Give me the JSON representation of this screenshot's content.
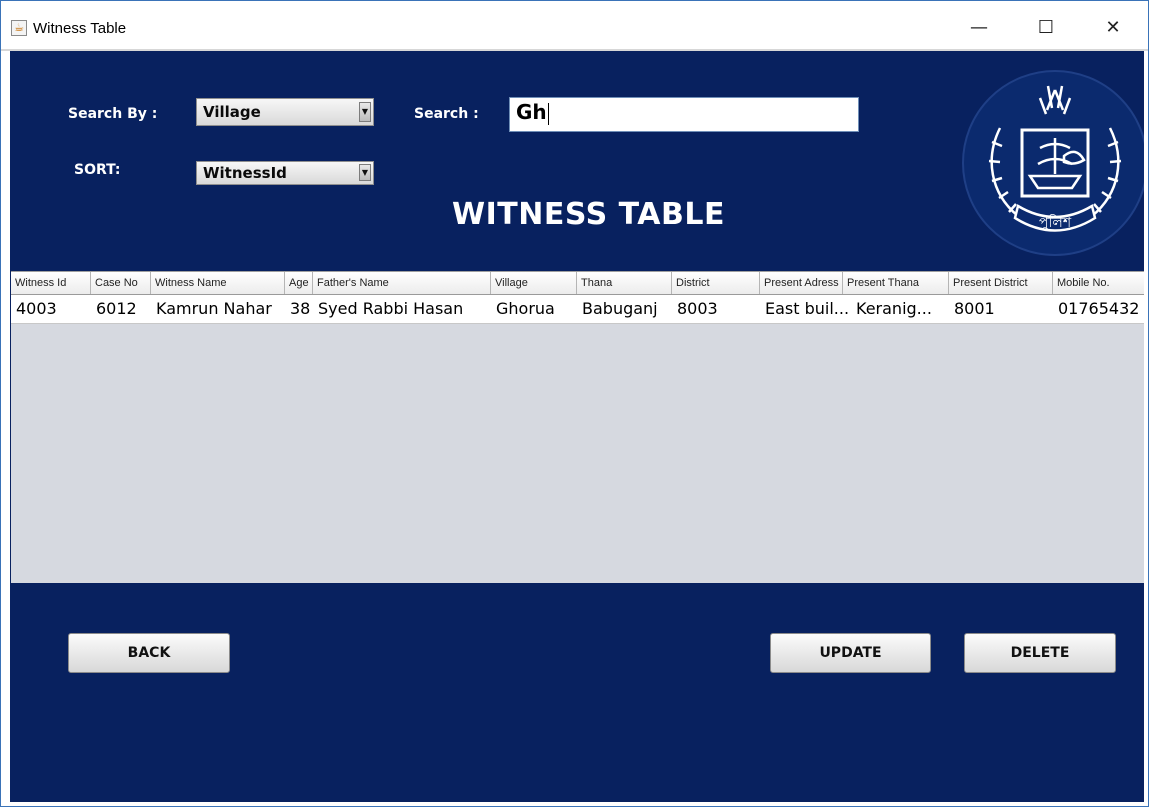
{
  "window": {
    "title": "Witness Table",
    "app_icon": "java-cup-icon",
    "controls": {
      "minimize": "—",
      "maximize": "☐",
      "close": "✕"
    }
  },
  "form": {
    "search_by_label": "Search By :",
    "search_by_value": "Village",
    "sort_label": "SORT:",
    "sort_value": "WitnessId",
    "search_label": "Search :",
    "search_value": "Gh",
    "dropdown_arrow": "▼"
  },
  "heading": "WITNESS TABLE",
  "logo": {
    "icon": "police-emblem-icon",
    "text": "পুলিশ"
  },
  "table": {
    "columns": [
      "Witness Id",
      "Case No",
      "Witness Name",
      "Age",
      "Father's Name",
      "Village",
      "Thana",
      "District",
      "Present Adress",
      "Present Thana",
      "Present District",
      "Mobile No."
    ],
    "rows": [
      [
        "4003",
        "6012",
        "Kamrun Nahar",
        "38",
        "Syed Rabbi Hasan",
        "Ghorua",
        "Babuganj",
        "8003",
        "East buil...",
        "Keranig...",
        "8001",
        "01765432"
      ]
    ]
  },
  "buttons": {
    "back": "BACK",
    "update": "UPDATE",
    "delete": "DELETE"
  },
  "colors": {
    "panel_bg": "#08215f",
    "table_bg": "#d6d9e0",
    "text_light": "#ffffff"
  }
}
